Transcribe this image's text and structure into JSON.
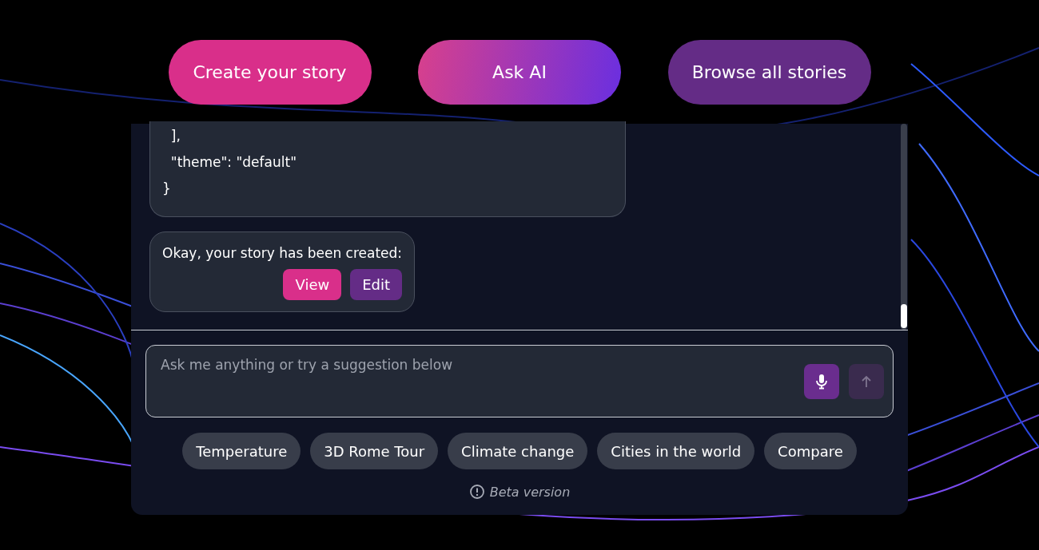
{
  "nav_buttons": [
    {
      "label": "Create your story",
      "kind": "pink"
    },
    {
      "label": "Ask AI",
      "kind": "gradient"
    },
    {
      "label": "Browse all stories",
      "kind": "purple"
    }
  ],
  "chat": {
    "messages": [
      {
        "kind": "code",
        "lines": [
          "  ],",
          "  \"theme\": \"default\"",
          "}"
        ]
      },
      {
        "kind": "result",
        "text": "Okay, your story has been created:",
        "actions": [
          {
            "label": "View",
            "kind": "pink"
          },
          {
            "label": "Edit",
            "kind": "purple"
          }
        ]
      }
    ],
    "input": {
      "placeholder": "Ask me anything or try a suggestion below",
      "send_disabled": true
    },
    "suggestions": [
      "Temperature",
      "3D Rome Tour",
      "Climate change",
      "Cities in the world",
      "Compare"
    ],
    "footer_note": "Beta version"
  }
}
